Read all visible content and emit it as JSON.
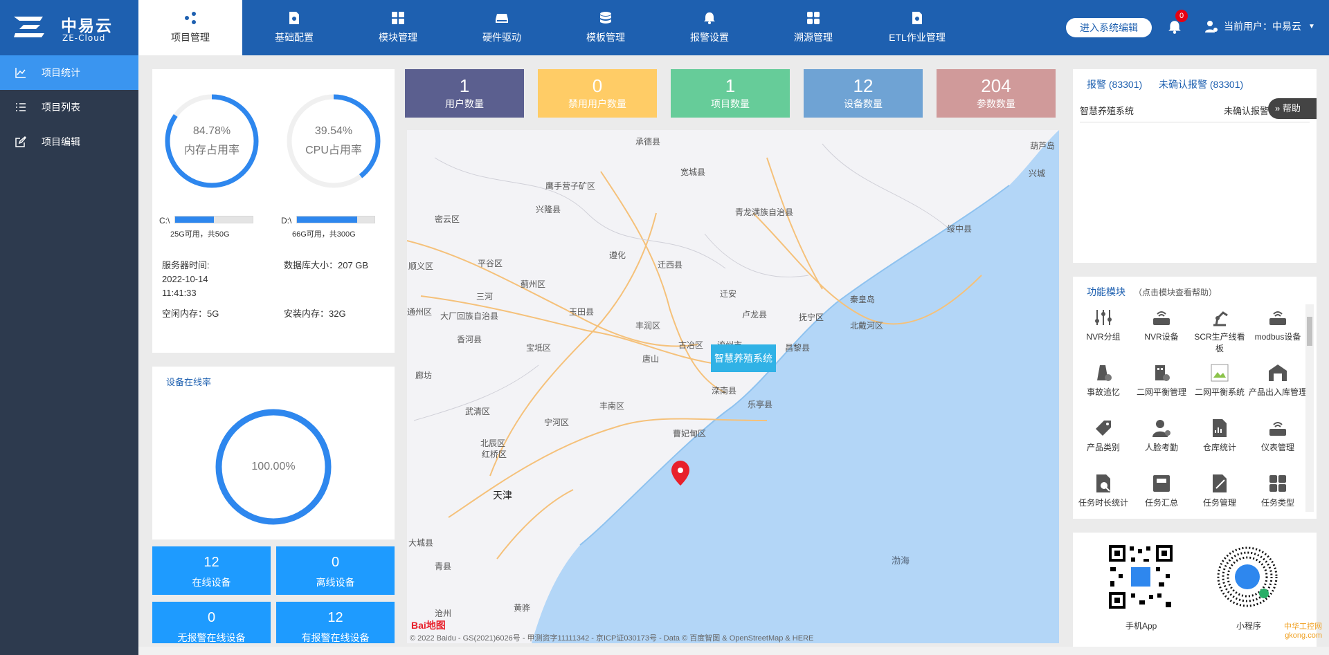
{
  "brand": {
    "name_cn": "中易云",
    "name_en": "ZE-Cloud"
  },
  "nav": [
    {
      "label": "项目管理",
      "icon": "share-icon"
    },
    {
      "label": "基础配置",
      "icon": "gear-doc-icon"
    },
    {
      "label": "模块管理",
      "icon": "modules-icon"
    },
    {
      "label": "硬件驱动",
      "icon": "drive-icon"
    },
    {
      "label": "模板管理",
      "icon": "database-icon"
    },
    {
      "label": "报警设置",
      "icon": "bell-icon"
    },
    {
      "label": "溯源管理",
      "icon": "grid-icon"
    },
    {
      "label": "ETL作业管理",
      "icon": "gear-doc-icon"
    }
  ],
  "header": {
    "enter_label": "进入系统编辑",
    "bell_count": "0",
    "user_label": "当前用户：中易云"
  },
  "sidebar": [
    {
      "label": "项目统计",
      "icon": "chart-line-icon"
    },
    {
      "label": "项目列表",
      "icon": "list-icon"
    },
    {
      "label": "项目编辑",
      "icon": "edit-icon"
    }
  ],
  "server": {
    "mem": {
      "percent": "84.78%",
      "label": "内存占用率",
      "value": 84.78
    },
    "cpu": {
      "percent": "39.54%",
      "label": "CPU占用率",
      "value": 39.54
    },
    "disk_c": {
      "name": "C:\\",
      "sub": "25G可用，共50G",
      "used_fraction": 0.5
    },
    "disk_d": {
      "name": "D:\\",
      "sub": "66G可用，共300G",
      "used_fraction": 0.78
    },
    "time_label": "服务器时间:",
    "time_date": "2022-10-14",
    "time_clock": "11:41:33",
    "db_size": "数据库大小：207 GB",
    "free_mem": "空闲内存：5G",
    "install_mem": "安装内存：32G"
  },
  "online": {
    "title": "设备在线率",
    "percent": "100.00%",
    "value": 100
  },
  "device_stats": [
    {
      "num": "12",
      "label": "在线设备"
    },
    {
      "num": "0",
      "label": "离线设备"
    },
    {
      "num": "0",
      "label": "无报警在线设备"
    },
    {
      "num": "12",
      "label": "有报警在线设备"
    }
  ],
  "kpis": [
    {
      "num": "1",
      "label": "用户数量",
      "color": "#5b5f8f"
    },
    {
      "num": "0",
      "label": "禁用用户数量",
      "color": "#ffcc66"
    },
    {
      "num": "1",
      "label": "项目数量",
      "color": "#66cc99"
    },
    {
      "num": "12",
      "label": "设备数量",
      "color": "#6fa3d4"
    },
    {
      "num": "204",
      "label": "参数数量",
      "color": "#d09a9a"
    }
  ],
  "map": {
    "popup": "智慧养殖系统",
    "footer": "© 2022 Baidu - GS(2021)6026号 - 甲测资字11111342 - 京ICP证030173号 - Data © 百度智图 & OpenStreetMap & HERE",
    "logo": "Bai地图",
    "places": [
      "承德县",
      "宽城县",
      "葫芦岛",
      "鹰手营子矿区",
      "兴城",
      "兴隆县",
      "青龙满族自治县",
      "密云区",
      "绥中县",
      "遵化",
      "迁西县",
      "平谷区",
      "顺义区",
      "蓟州区",
      "三河",
      "秦皇岛",
      "迁安",
      "通州区",
      "玉田县",
      "卢龙县",
      "抚宁区",
      "大厂回族自治县",
      "丰润区",
      "古冶区",
      "滦州市",
      "北戴河区",
      "香河县",
      "宝坻区",
      "唐山",
      "昌黎县",
      "廊坊",
      "丰南区",
      "滦南县",
      "乐亭县",
      "武清区",
      "宁河区",
      "曹妃甸区",
      "北辰区",
      "红桥区",
      "天津",
      "大城县",
      "青县",
      "黄骅",
      "沧州"
    ],
    "sea": "渤海"
  },
  "alarm": {
    "tab_alarm": "报警 (83301)",
    "tab_unconfirmed": "未确认报警 (83301)",
    "row_name": "智慧养殖系统",
    "row_status": "未确认报警",
    "help": "帮助"
  },
  "modules": {
    "title": "功能模块",
    "hint": "（点击模块查看帮助）",
    "items": [
      {
        "label": "NVR分组",
        "icon": "sliders-icon"
      },
      {
        "label": "NVR设备",
        "icon": "router-icon"
      },
      {
        "label": "SCR生产线看板",
        "icon": "robot-arm-icon"
      },
      {
        "label": "modbus设备",
        "icon": "router-icon"
      },
      {
        "label": "事故追忆",
        "icon": "server-gear-icon"
      },
      {
        "label": "二网平衡管理",
        "icon": "building-gear-icon"
      },
      {
        "label": "二网平衡系统",
        "icon": "broken-image-icon"
      },
      {
        "label": "产品出入库管理",
        "icon": "warehouse-icon"
      },
      {
        "label": "产品类别",
        "icon": "tag-icon"
      },
      {
        "label": "人脸考勤",
        "icon": "user-gear-icon"
      },
      {
        "label": "仓库统计",
        "icon": "doc-chart-icon"
      },
      {
        "label": "仪表管理",
        "icon": "router-icon"
      },
      {
        "label": "任务时长统计",
        "icon": "doc-search-icon"
      },
      {
        "label": "任务汇总",
        "icon": "folder-icon"
      },
      {
        "label": "任务管理",
        "icon": "doc-edit-icon"
      },
      {
        "label": "任务类型",
        "icon": "grid-icon"
      }
    ]
  },
  "apps": {
    "mobile": "手机App",
    "mini": "小程序"
  },
  "watermark": "中华工控网 gkong.com"
}
